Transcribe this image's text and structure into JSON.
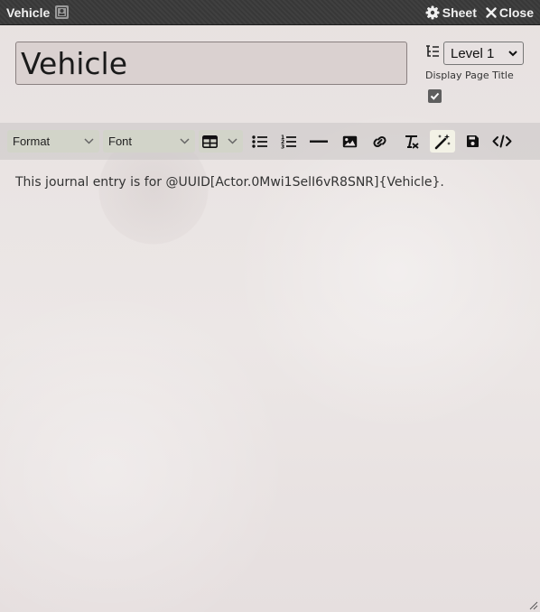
{
  "window": {
    "title": "Vehicle",
    "id_badge_icon": "id-card-icon",
    "sheet_label": "Sheet",
    "close_label": "Close"
  },
  "page": {
    "title_value": "Vehicle",
    "level_selected": "Level 1",
    "display_title_label": "Display Page Title",
    "display_title_checked": true
  },
  "toolbar": {
    "format_label": "Format",
    "font_label": "Font",
    "buttons": [
      "table-icon",
      "bullet-list-icon",
      "numbered-list-icon",
      "horizontal-rule-icon",
      "image-icon",
      "link-icon",
      "clear-format-icon",
      "magic-wand-icon",
      "save-icon",
      "source-code-icon"
    ],
    "active_button": "magic-wand-icon"
  },
  "editor": {
    "text": "This journal entry is for @UUID[Actor.0Mwi1SelI6vR8SNR]{Vehicle}."
  },
  "colors": {
    "titlebar": "#3a3a3a",
    "background": "#e8e2e2",
    "toolbar": "#cfcaca",
    "dropdown": "#d2d4c8"
  }
}
